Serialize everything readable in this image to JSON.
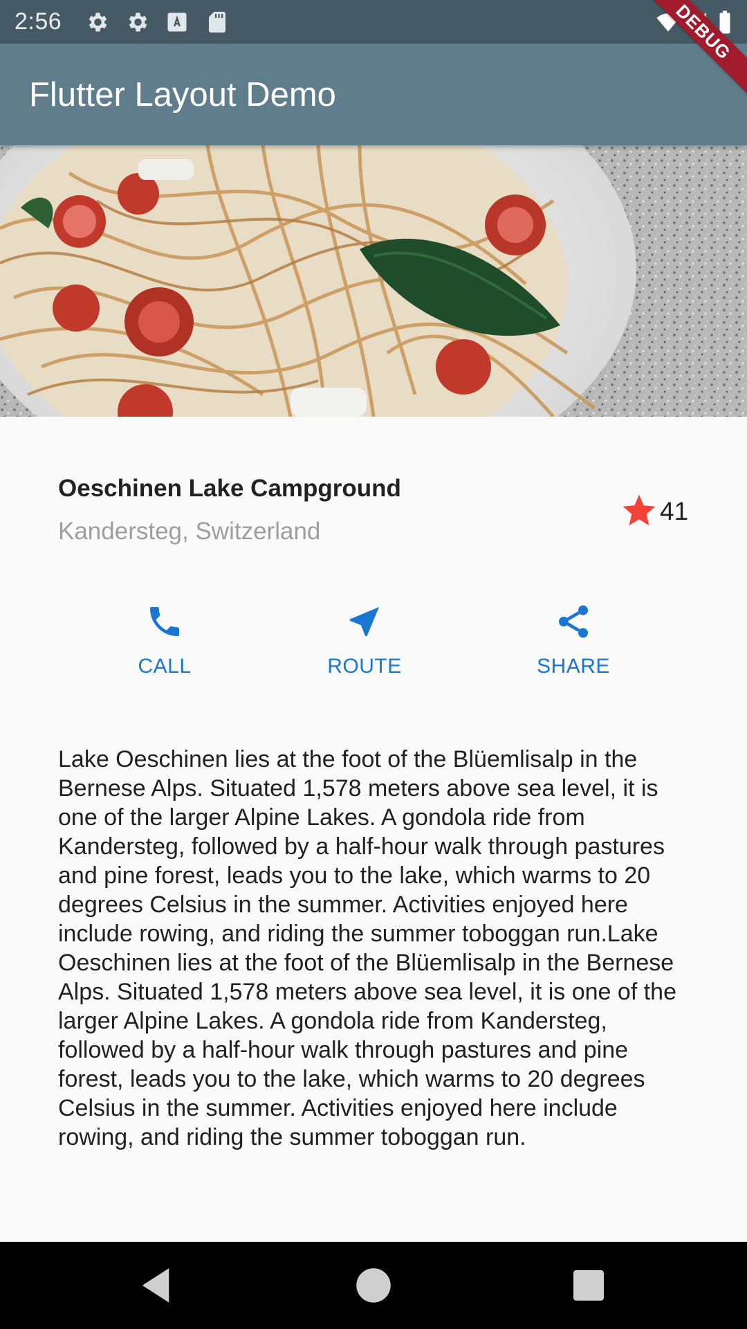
{
  "status_bar": {
    "time": "2:56",
    "icons": [
      "settings-icon",
      "settings-icon",
      "text-icon",
      "sd-card-icon"
    ],
    "right_icons": [
      "wifi-icon",
      "signal-icon",
      "battery-icon"
    ]
  },
  "app_bar": {
    "title": "Flutter Layout Demo"
  },
  "debug_banner": {
    "label": "DEBUG"
  },
  "place": {
    "name": "Oeschinen Lake Campground",
    "location": "Kandersteg, Switzerland",
    "star_count": "41",
    "star_color": "#f44336"
  },
  "actions": [
    {
      "icon": "phone-icon",
      "label": "CALL"
    },
    {
      "icon": "navigation-icon",
      "label": "ROUTE"
    },
    {
      "icon": "share-icon",
      "label": "SHARE"
    }
  ],
  "accent_color": "#1976d2",
  "description": "Lake Oeschinen lies at the foot of the Blüemlisalp in the Bernese Alps. Situated 1,578 meters above sea level, it is one of the larger Alpine Lakes. A gondola ride from Kandersteg, followed by a half-hour walk through pastures and pine forest, leads you to the lake, which warms to 20 degrees Celsius in the summer. Activities enjoyed here include rowing, and riding the summer toboggan run.Lake Oeschinen lies at the foot of the Blüemlisalp in the Bernese Alps. Situated 1,578 meters above sea level, it is one of the larger Alpine Lakes. A gondola ride from Kandersteg, followed by a half-hour walk through pastures and pine forest, leads you to the lake, which warms to 20 degrees Celsius in the summer. Activities enjoyed here include rowing, and riding the summer toboggan run.",
  "nav_bar": {
    "buttons": [
      "back-icon",
      "home-icon",
      "recents-icon"
    ]
  }
}
